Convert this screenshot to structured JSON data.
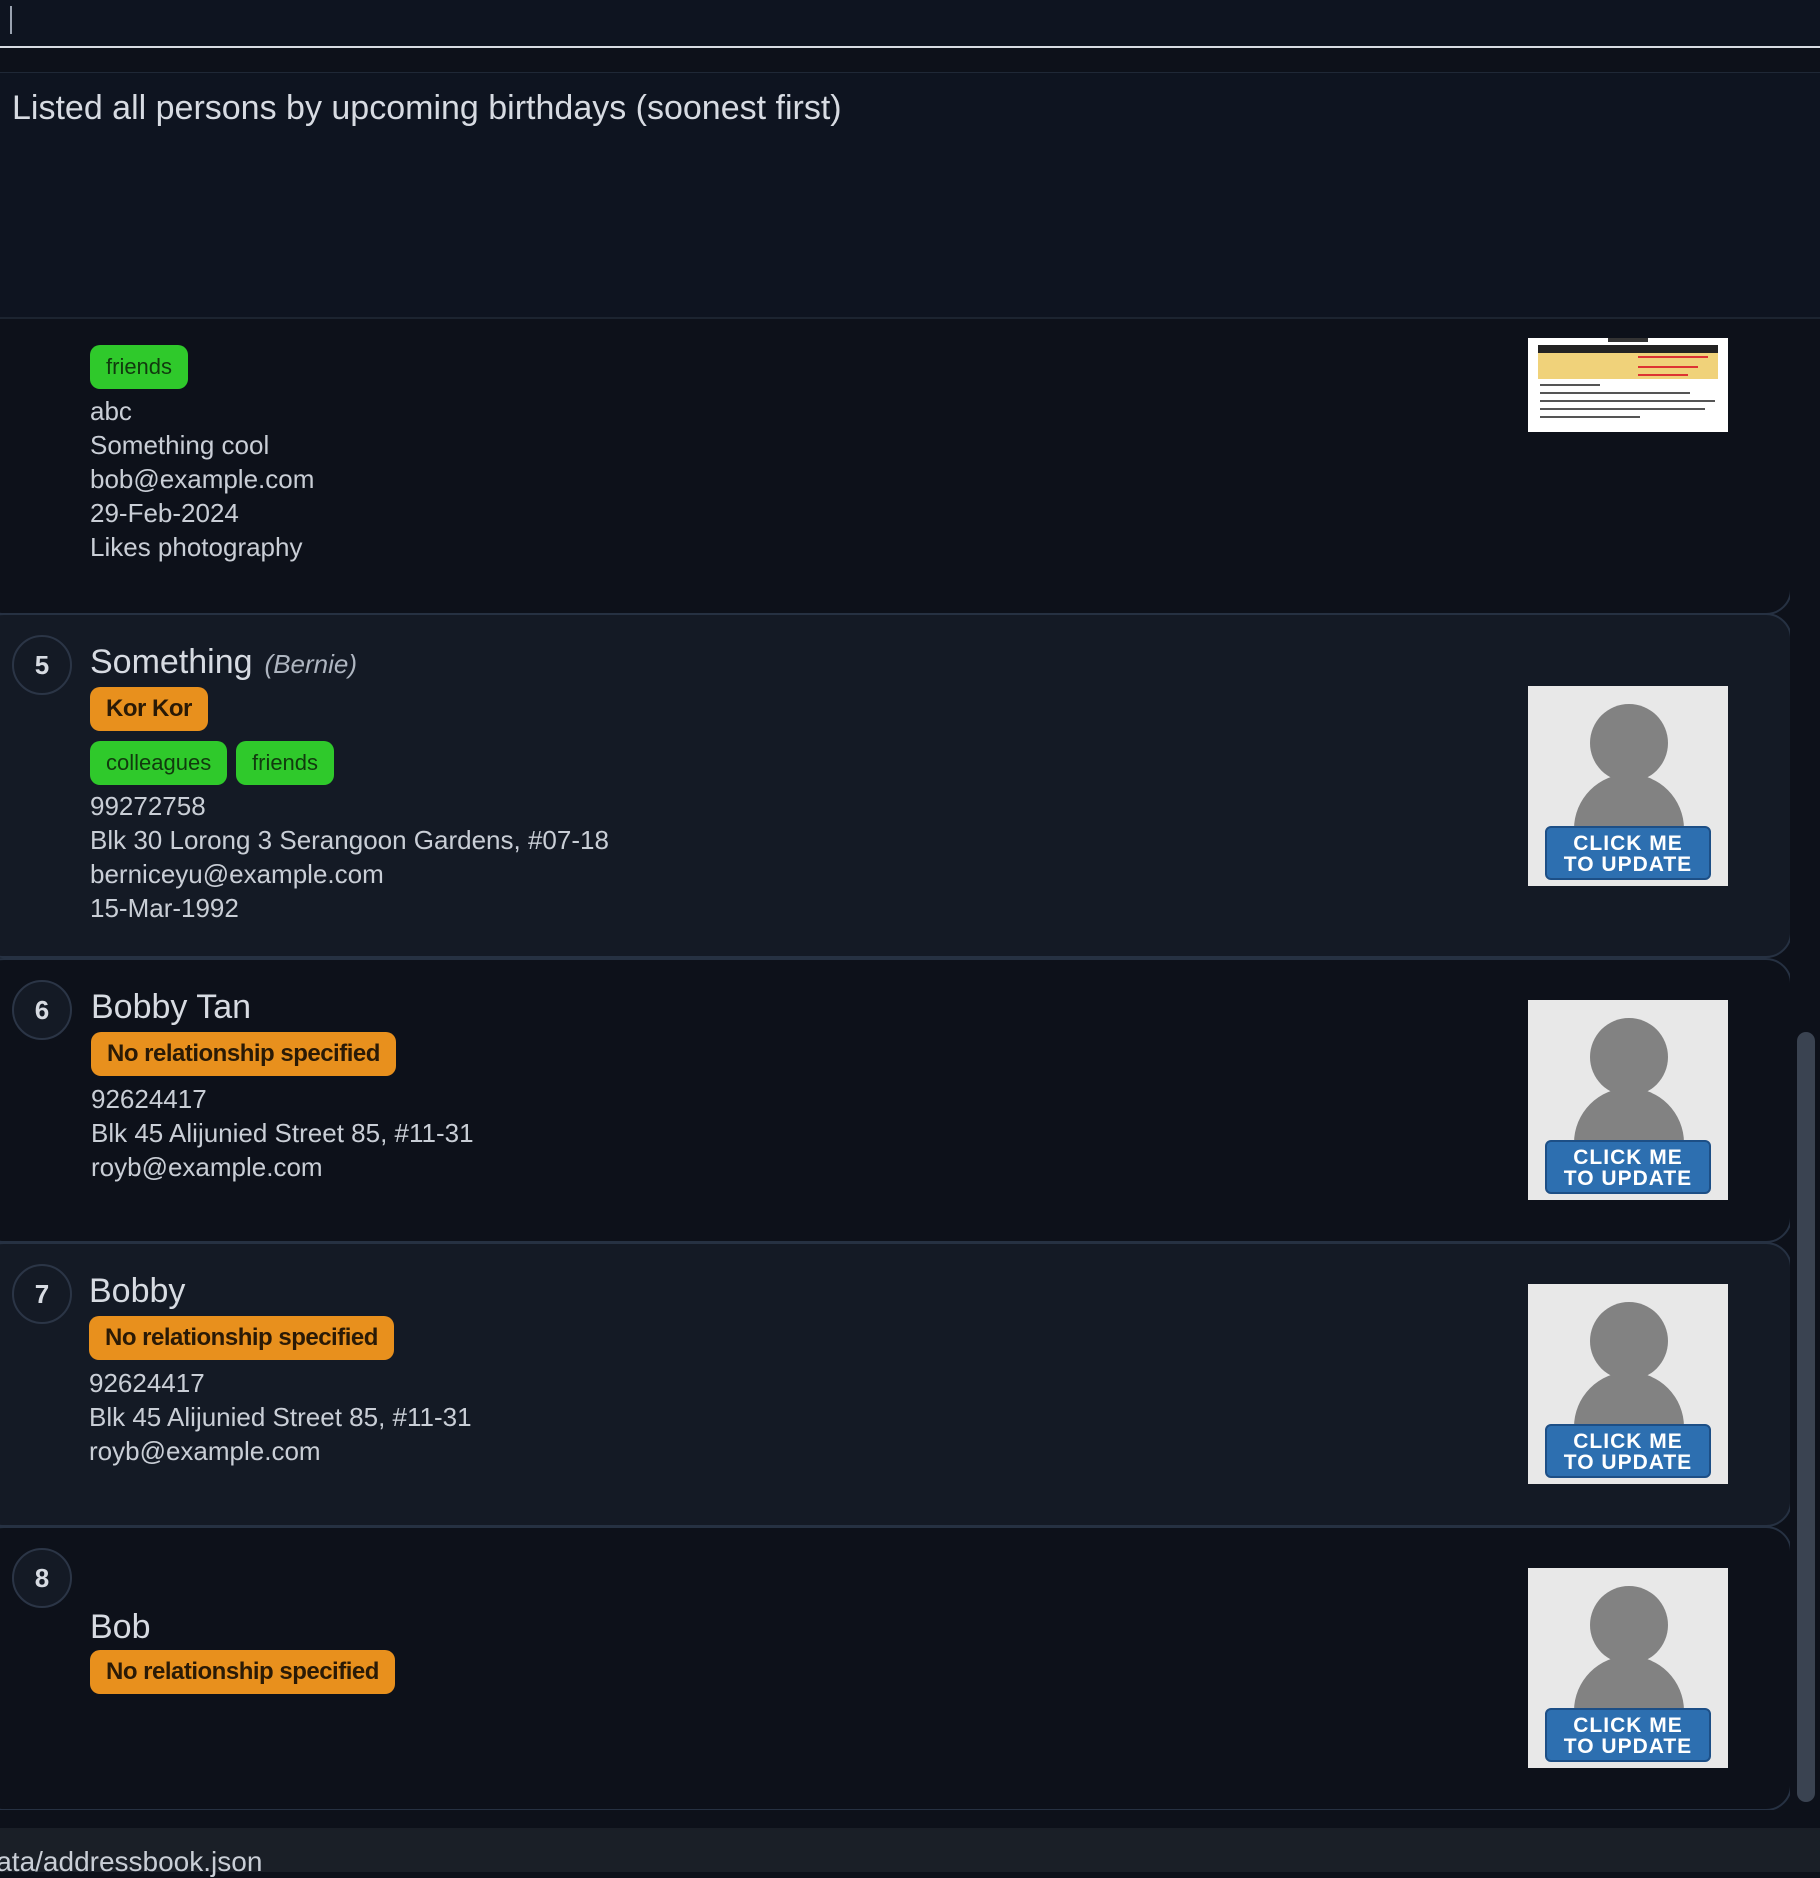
{
  "command_box": {
    "value": ""
  },
  "result_display": {
    "text": "Listed all persons by upcoming birthdays (soonest first)"
  },
  "persons": [
    {
      "tags": [
        "friends"
      ],
      "fields": [
        "abc",
        "Something cool",
        "bob@example.com",
        "29-Feb-2024",
        "Likes photography"
      ]
    },
    {
      "index": "5",
      "name": "Something",
      "nickname": "(Bernie)",
      "relationship": "Kor Kor",
      "tags": [
        "colleagues",
        "friends"
      ],
      "phone": "99272758",
      "address": "Blk 30 Lorong 3 Serangoon Gardens, #07-18",
      "email": "berniceyu@example.com",
      "birthday": "15-Mar-1992",
      "photo_button": "CLICK ME TO UPDATE"
    },
    {
      "index": "6",
      "name": "Bobby Tan",
      "relationship": "No relationship specified",
      "phone": "92624417",
      "address": "Blk 45 Alijunied Street 85, #11-31",
      "email": "royb@example.com",
      "photo_button": "CLICK ME TO UPDATE"
    },
    {
      "index": "7",
      "name": "Bobby",
      "relationship": "No relationship specified",
      "phone": "92624417",
      "address": "Blk 45 Alijunied Street 85, #11-31",
      "email": "royb@example.com",
      "photo_button": "CLICK ME TO UPDATE"
    },
    {
      "index": "8",
      "name": "Bob",
      "relationship": "No relationship specified",
      "photo_button": "CLICK ME TO UPDATE"
    }
  ],
  "status_bar": {
    "path": "lata/addressbook.json"
  },
  "colors": {
    "relationship_badge": "#e8901d",
    "tag_badge": "#2fc92b",
    "update_button": "#2d6fb0"
  }
}
